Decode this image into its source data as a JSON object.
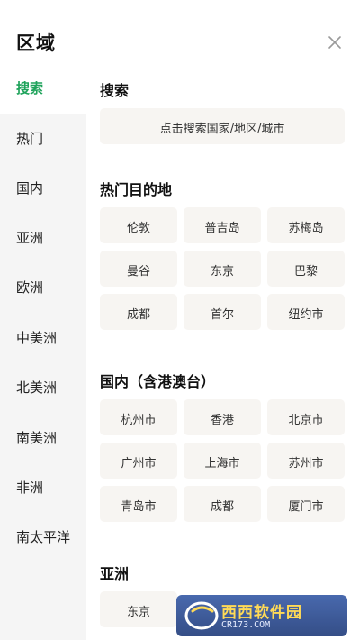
{
  "header": {
    "title": "区域"
  },
  "sidebar": {
    "items": [
      {
        "label": "搜索"
      },
      {
        "label": "热门"
      },
      {
        "label": "国内"
      },
      {
        "label": "亚洲"
      },
      {
        "label": "欧洲"
      },
      {
        "label": "中美洲"
      },
      {
        "label": "北美洲"
      },
      {
        "label": "南美洲"
      },
      {
        "label": "非洲"
      },
      {
        "label": "南太平洋"
      }
    ],
    "active_color": "#1fa35b"
  },
  "main": {
    "search": {
      "title": "搜索",
      "placeholder": "点击搜索国家/地区/城市"
    },
    "hot": {
      "title": "热门目的地",
      "items": [
        "伦敦",
        "普吉岛",
        "苏梅岛",
        "曼谷",
        "东京",
        "巴黎",
        "成都",
        "首尔",
        "纽约市"
      ]
    },
    "domestic": {
      "title": "国内（含港澳台）",
      "items": [
        "杭州市",
        "香港",
        "北京市",
        "广州市",
        "上海市",
        "苏州市",
        "青岛市",
        "成都",
        "厦门市"
      ]
    },
    "asia": {
      "title": "亚洲",
      "items": [
        "东京"
      ]
    }
  },
  "watermark": {
    "text": "西西软件园",
    "sub": "CR173.COM"
  }
}
